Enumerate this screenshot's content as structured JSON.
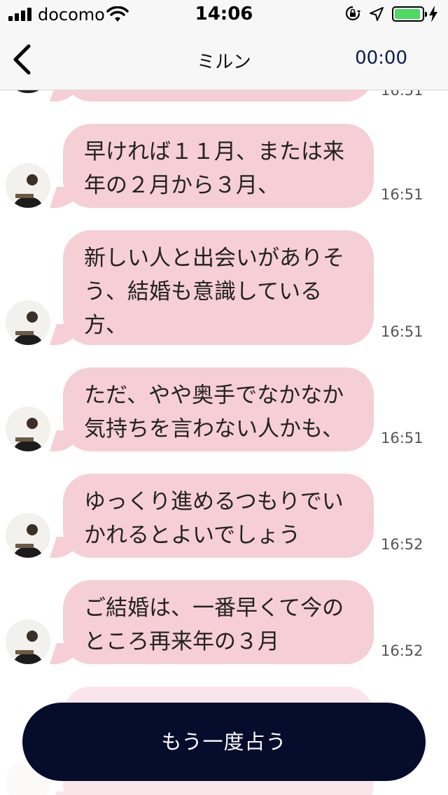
{
  "status": {
    "carrier": "docomo",
    "time": "14:06"
  },
  "nav": {
    "title": "ミルン",
    "timer": "00:00"
  },
  "messages": [
    {
      "text": "",
      "time": "16:51"
    },
    {
      "text": "早ければ１１月、または来年の２月から３月、",
      "time": "16:51"
    },
    {
      "text": "新しい人と出会いがありそう、結婚も意識している方、",
      "time": "16:51"
    },
    {
      "text": "ただ、やや奥手でなかなか気持ちを言わない人かも、",
      "time": "16:51"
    },
    {
      "text": "ゆっくり進めるつもりでいかれるとよいでしょう",
      "time": "16:52"
    },
    {
      "text": "ご結婚は、一番早くて今のところ再来年の３月",
      "time": "16:52"
    }
  ],
  "cta": {
    "label": "もう一度占う"
  },
  "colors": {
    "bubble": "#f6ced5",
    "button": "#060c2c",
    "battery": "#4cd964",
    "timer": "#0d1b4d"
  }
}
